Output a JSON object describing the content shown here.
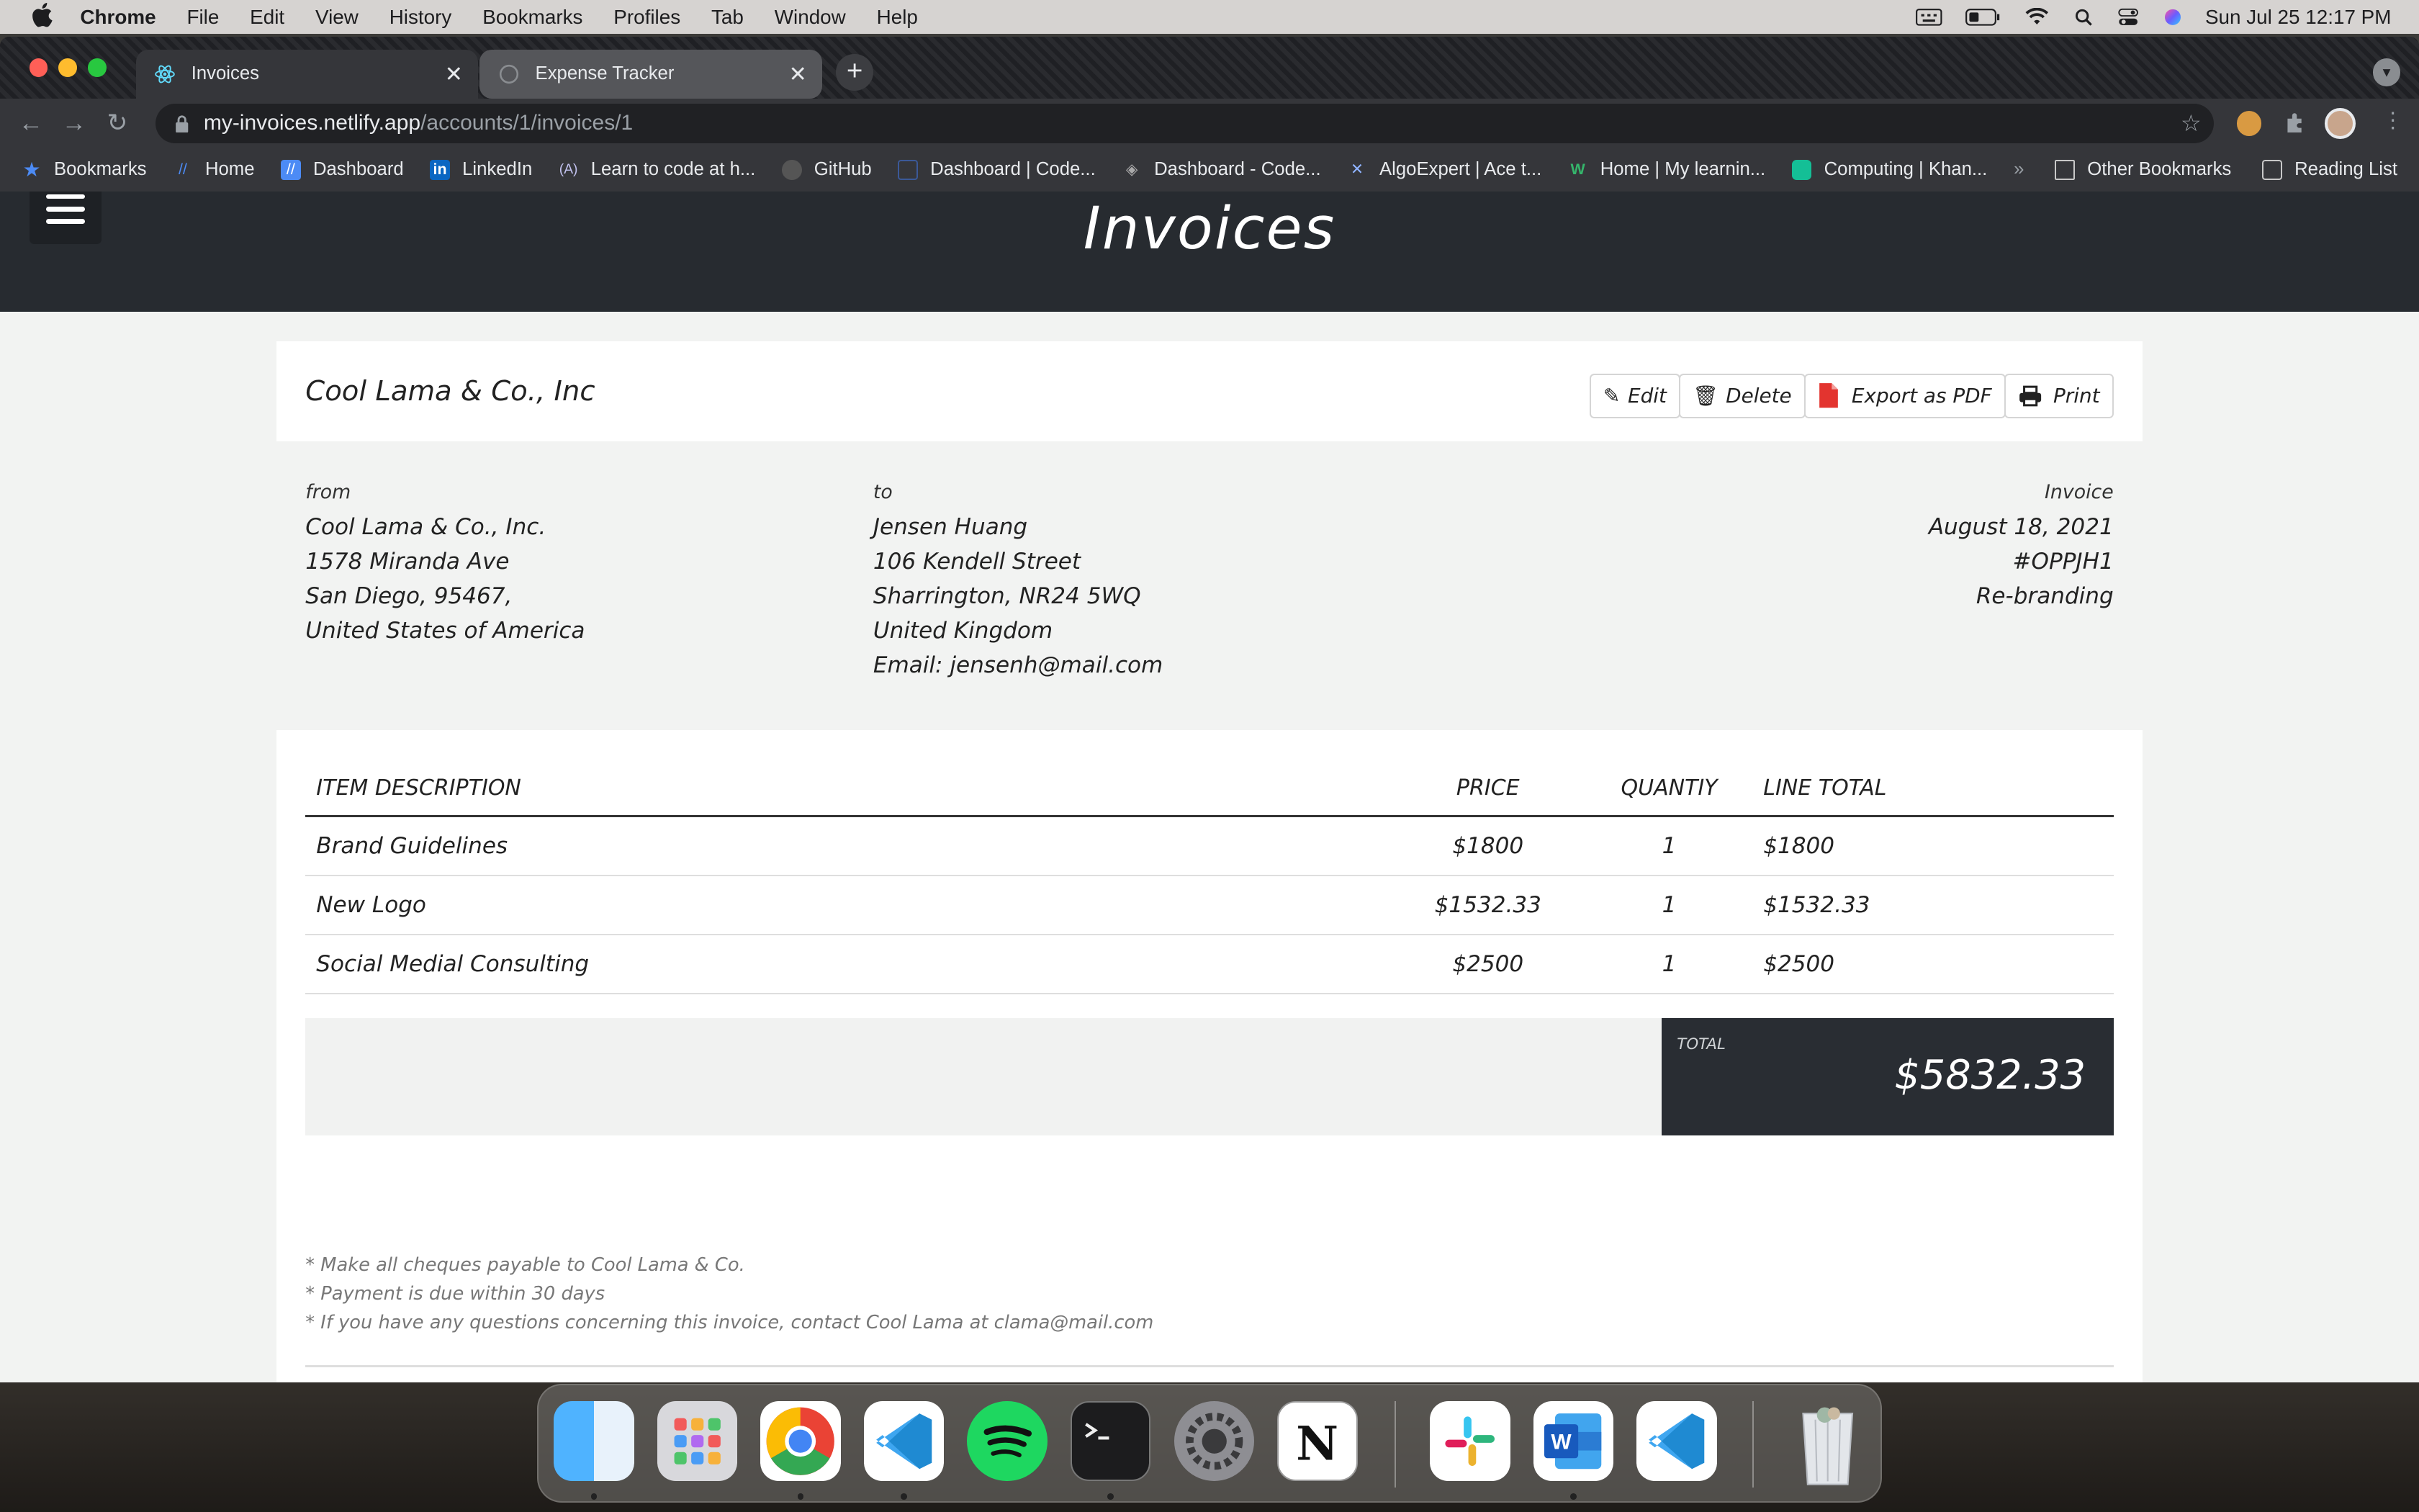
{
  "menubar": {
    "app": "Chrome",
    "items": [
      "File",
      "Edit",
      "View",
      "History",
      "Bookmarks",
      "Profiles",
      "Tab",
      "Window",
      "Help"
    ],
    "datetime": "Sun Jul 25  12:17 PM"
  },
  "browser": {
    "tabs": [
      {
        "title": "Invoices",
        "active": true
      },
      {
        "title": "Expense Tracker",
        "active": false
      }
    ],
    "url_host": "my-invoices.netlify.app",
    "url_path": "/accounts/1/invoices/1",
    "bookmarks": [
      {
        "label": "Bookmarks",
        "icon": "star-icon",
        "color": "#4c8bf5"
      },
      {
        "label": "Home",
        "icon": "slash-icon",
        "color": "#4c8bf5"
      },
      {
        "label": "Dashboard",
        "icon": "slash-icon",
        "color": "#4c8bf5"
      },
      {
        "label": "LinkedIn",
        "icon": "linkedin-icon",
        "color": "#0a66c2"
      },
      {
        "label": "Learn to code at h...",
        "icon": "code-icon",
        "color": "#7b7bd0"
      },
      {
        "label": "GitHub",
        "icon": "github-icon",
        "color": "#555555"
      },
      {
        "label": "Dashboard | Code...",
        "icon": "doc-icon",
        "color": "#3b5998"
      },
      {
        "label": "Dashboard - Code...",
        "icon": "cube-icon",
        "color": "#aaaaaa"
      },
      {
        "label": "AlgoExpert | Ace t...",
        "icon": "algo-icon",
        "color": "#8fb3ff"
      },
      {
        "label": "Home | My learnin...",
        "icon": "w-icon",
        "color": "#35b56b"
      },
      {
        "label": "Computing | Khan...",
        "icon": "khan-icon",
        "color": "#14bf96"
      }
    ],
    "bookmarks_right": [
      "Other Bookmarks",
      "Reading List"
    ]
  },
  "app": {
    "title": "Invoices",
    "company": "Cool Lama & Co., Inc",
    "actions": {
      "edit": "Edit",
      "delete": "Delete",
      "export": "Export as PDF",
      "print": "Print"
    },
    "from": {
      "label": "from",
      "lines": [
        "Cool Lama & Co., Inc.",
        "1578 Miranda Ave",
        "San Diego, 95467,",
        "United States of America"
      ]
    },
    "to": {
      "label": "to",
      "lines": [
        "Jensen Huang",
        "106 Kendell Street",
        "Sharrington, NR24 5WQ",
        "United Kingdom",
        "Email: jensenh@mail.com"
      ]
    },
    "invoice": {
      "label": "Invoice",
      "date": "August 18, 2021",
      "number": "#OPPJH1",
      "project": "Re-branding"
    },
    "table": {
      "headers": [
        "ITEM DESCRIPTION",
        "PRICE",
        "QUANTIY",
        "LINE TOTAL"
      ],
      "rows": [
        [
          "Brand Guidelines",
          "$1800",
          "1",
          "$1800"
        ],
        [
          "New Logo",
          "$1532.33",
          "1",
          "$1532.33"
        ],
        [
          "Social Medial Consulting",
          "$2500",
          "1",
          "$2500"
        ]
      ]
    },
    "total": {
      "label": "TOTAL",
      "value": "$5832.33"
    },
    "notes": [
      "* Make all cheques payable to Cool Lama & Co.",
      "* Payment is due within 30 days",
      "* If you have any questions concerning this invoice, contact Cool Lama at clama@mail.com"
    ]
  },
  "dock": [
    "finder-icon",
    "launchpad-icon",
    "chrome-icon",
    "vscode-icon",
    "spotify-icon",
    "terminal-icon",
    "system-preferences-icon",
    "notion-icon",
    "slack-icon",
    "word-icon",
    "vscode-icon",
    "trash-icon"
  ]
}
